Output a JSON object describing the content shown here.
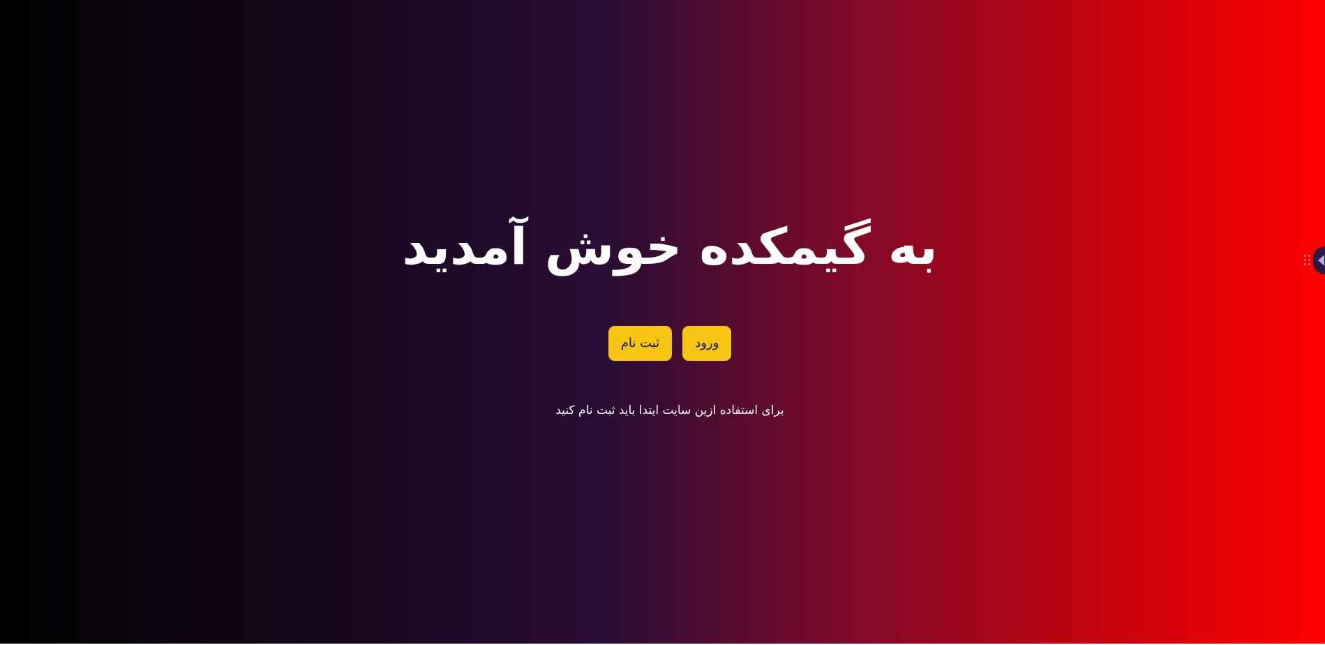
{
  "hero": {
    "title": "به گیمکده خوش آمدید",
    "subtitle": "برای استفاده ازین سایت ایتدا باید ثبت نام کنید"
  },
  "actions": {
    "login_label": "ورود",
    "register_label": "ثبت نام"
  },
  "side_widget": {
    "grip_icon": "drag-handle-icon",
    "toggle_icon": "chevron-left-icon"
  },
  "colors": {
    "button_bg": "#f8c514",
    "gradient": [
      "#000000",
      "#2a0d35",
      "#7a0a2a",
      "#c0040f",
      "#ff0000"
    ]
  }
}
